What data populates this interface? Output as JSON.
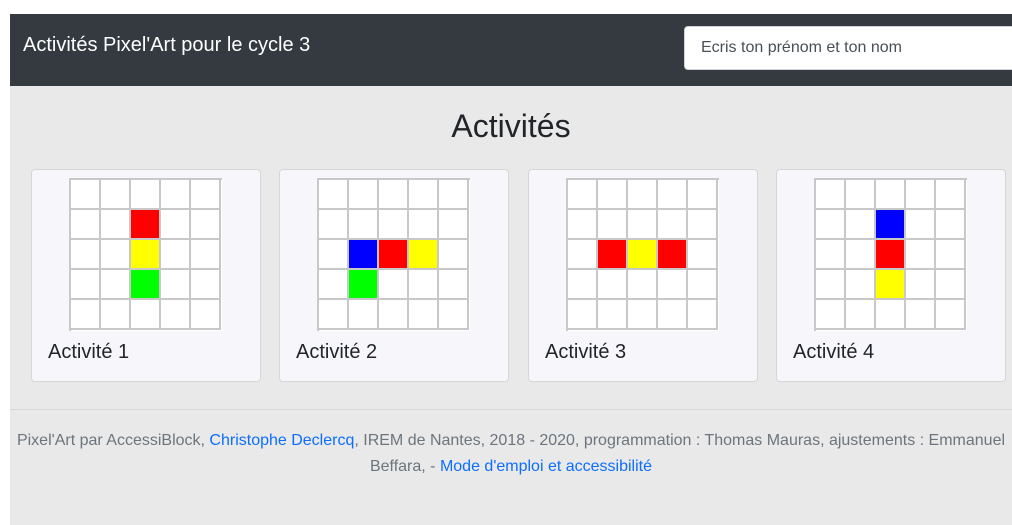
{
  "header": {
    "title": "Activités Pixel'Art pour le cycle 3",
    "name_input_placeholder": "Ecris ton prénom et ton nom"
  },
  "main": {
    "heading": "Activités"
  },
  "colors": {
    "red": "#ff0000",
    "yellow": "#ffff00",
    "green": "#00ff00",
    "blue": "#0000ff",
    "empty": "#ffffff"
  },
  "activities": [
    {
      "label": "Activité 1",
      "grid": [
        [
          "",
          "",
          "",
          "",
          ""
        ],
        [
          "",
          "",
          "red",
          "",
          ""
        ],
        [
          "",
          "",
          "yellow",
          "",
          ""
        ],
        [
          "",
          "",
          "green",
          "",
          ""
        ],
        [
          "",
          "",
          "",
          "",
          ""
        ]
      ]
    },
    {
      "label": "Activité 2",
      "grid": [
        [
          "",
          "",
          "",
          "",
          ""
        ],
        [
          "",
          "",
          "",
          "",
          ""
        ],
        [
          "",
          "blue",
          "red",
          "yellow",
          ""
        ],
        [
          "",
          "green",
          "",
          "",
          ""
        ],
        [
          "",
          "",
          "",
          "",
          ""
        ]
      ]
    },
    {
      "label": "Activité 3",
      "grid": [
        [
          "",
          "",
          "",
          "",
          ""
        ],
        [
          "",
          "",
          "",
          "",
          ""
        ],
        [
          "",
          "red",
          "yellow",
          "red",
          ""
        ],
        [
          "",
          "",
          "",
          "",
          ""
        ],
        [
          "",
          "",
          "",
          "",
          ""
        ]
      ]
    },
    {
      "label": "Activité 4",
      "grid": [
        [
          "",
          "",
          "",
          "",
          ""
        ],
        [
          "",
          "",
          "blue",
          "",
          ""
        ],
        [
          "",
          "",
          "red",
          "",
          ""
        ],
        [
          "",
          "",
          "yellow",
          "",
          ""
        ],
        [
          "",
          "",
          "",
          "",
          ""
        ]
      ]
    }
  ],
  "footer": {
    "text_before_link": "Pixel'Art par AccessiBlock, ",
    "author_link": "Christophe Declercq",
    "text_middle": ", IREM de Nantes, 2018 - 2020, programmation : Thomas Mauras, ajustements : Emmanuel Beffara, - ",
    "help_link": "Mode d'emploi et accessibilité"
  }
}
